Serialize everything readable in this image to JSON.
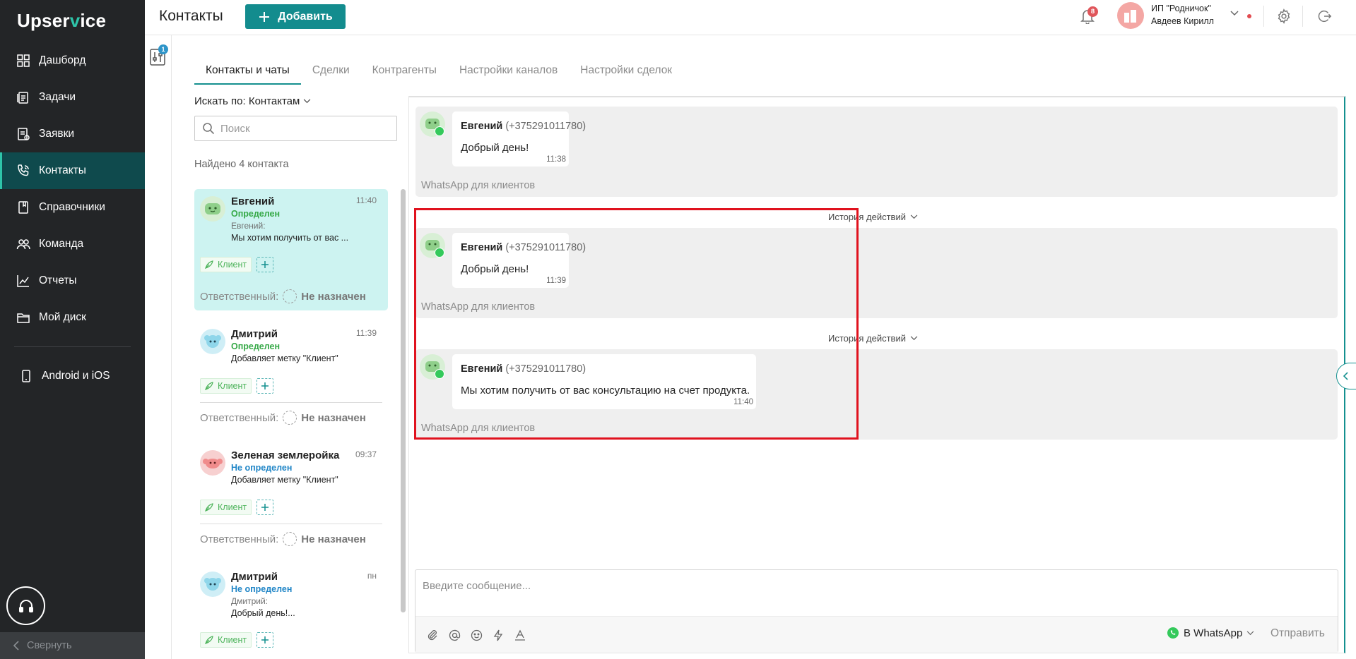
{
  "brand": {
    "logo_prefix": "Upser",
    "logo_v": "v",
    "logo_suffix": "ice"
  },
  "sidebar": {
    "items": [
      {
        "label": "Дашборд",
        "icon": "dashboard-icon"
      },
      {
        "label": "Задачи",
        "icon": "tasks-icon"
      },
      {
        "label": "Заявки",
        "icon": "requests-icon"
      },
      {
        "label": "Контакты",
        "icon": "contacts-icon",
        "active": true
      },
      {
        "label": "Справочники",
        "icon": "reference-book-icon"
      },
      {
        "label": "Команда",
        "icon": "team-icon"
      },
      {
        "label": "Отчеты",
        "icon": "reports-icon"
      },
      {
        "label": "Мой диск",
        "icon": "folder-icon"
      }
    ],
    "mobile_label": "Android и iOS",
    "collapse_label": "Свернуть"
  },
  "header": {
    "title": "Контакты",
    "add_label": "Добавить",
    "notifications_count": "8",
    "org_line1": "ИП \"Родничок\"",
    "org_line2": "Авдеев Кирилл"
  },
  "filter": {
    "badge": "1"
  },
  "tabs": [
    {
      "label": "Контакты и чаты",
      "active": true
    },
    {
      "label": "Сделки"
    },
    {
      "label": "Контрагенты"
    },
    {
      "label": "Настройки каналов"
    },
    {
      "label": "Настройки сделок"
    }
  ],
  "list": {
    "search_by": "Искать по: Контактам",
    "search_placeholder": "Поиск",
    "found": "Найдено 4 контакта",
    "tag_label": "Клиент",
    "resp_label": "Ответственный:",
    "resp_value": "Не назначен",
    "contacts": [
      {
        "name": "Евгений",
        "time": "11:40",
        "status": "Определен",
        "sender": "Евгений:",
        "preview": "Мы хотим получить от вас ...",
        "avatar_color": "#d8efd5"
      },
      {
        "name": "Дмитрий",
        "time": "11:39",
        "status": "Определен",
        "sender": "",
        "preview": "Добавляет метку \"Клиент\"",
        "avatar_color": "#cfeef6"
      },
      {
        "name": "Зеленая землеройка",
        "time": "09:37",
        "status": "Не определен",
        "sender": "",
        "preview": "Добавляет метку \"Клиент\"",
        "avatar_color": "#f7d0d0"
      },
      {
        "name": "Дмитрий",
        "time": "пн",
        "status": "Не определен",
        "sender": "Дмитрий:",
        "preview": "Добрый день!...",
        "avatar_color": "#cfeef6"
      }
    ]
  },
  "chat": {
    "channel": "WhatsApp для клиентов",
    "history_label": "История действий",
    "messages": [
      {
        "name": "Евгений",
        "phone": "(+375291011780)",
        "text": "Добрый день!",
        "time": "11:38"
      },
      {
        "name": "Евгений",
        "phone": "(+375291011780)",
        "text": "Добрый день!",
        "time": "11:39"
      },
      {
        "name": "Евгений",
        "phone": "(+375291011780)",
        "text": "Мы хотим получить от вас консультацию на счет продукта.",
        "time": "11:40"
      }
    ],
    "input_placeholder": "Введите сообщение...",
    "channel_select": "В WhatsApp",
    "send_label": "Отправить"
  },
  "colors": {
    "accent": "#138c8e",
    "sidebar_bg": "#232527",
    "selected_card": "#cdf3f1",
    "highlight": "#e0121e"
  }
}
